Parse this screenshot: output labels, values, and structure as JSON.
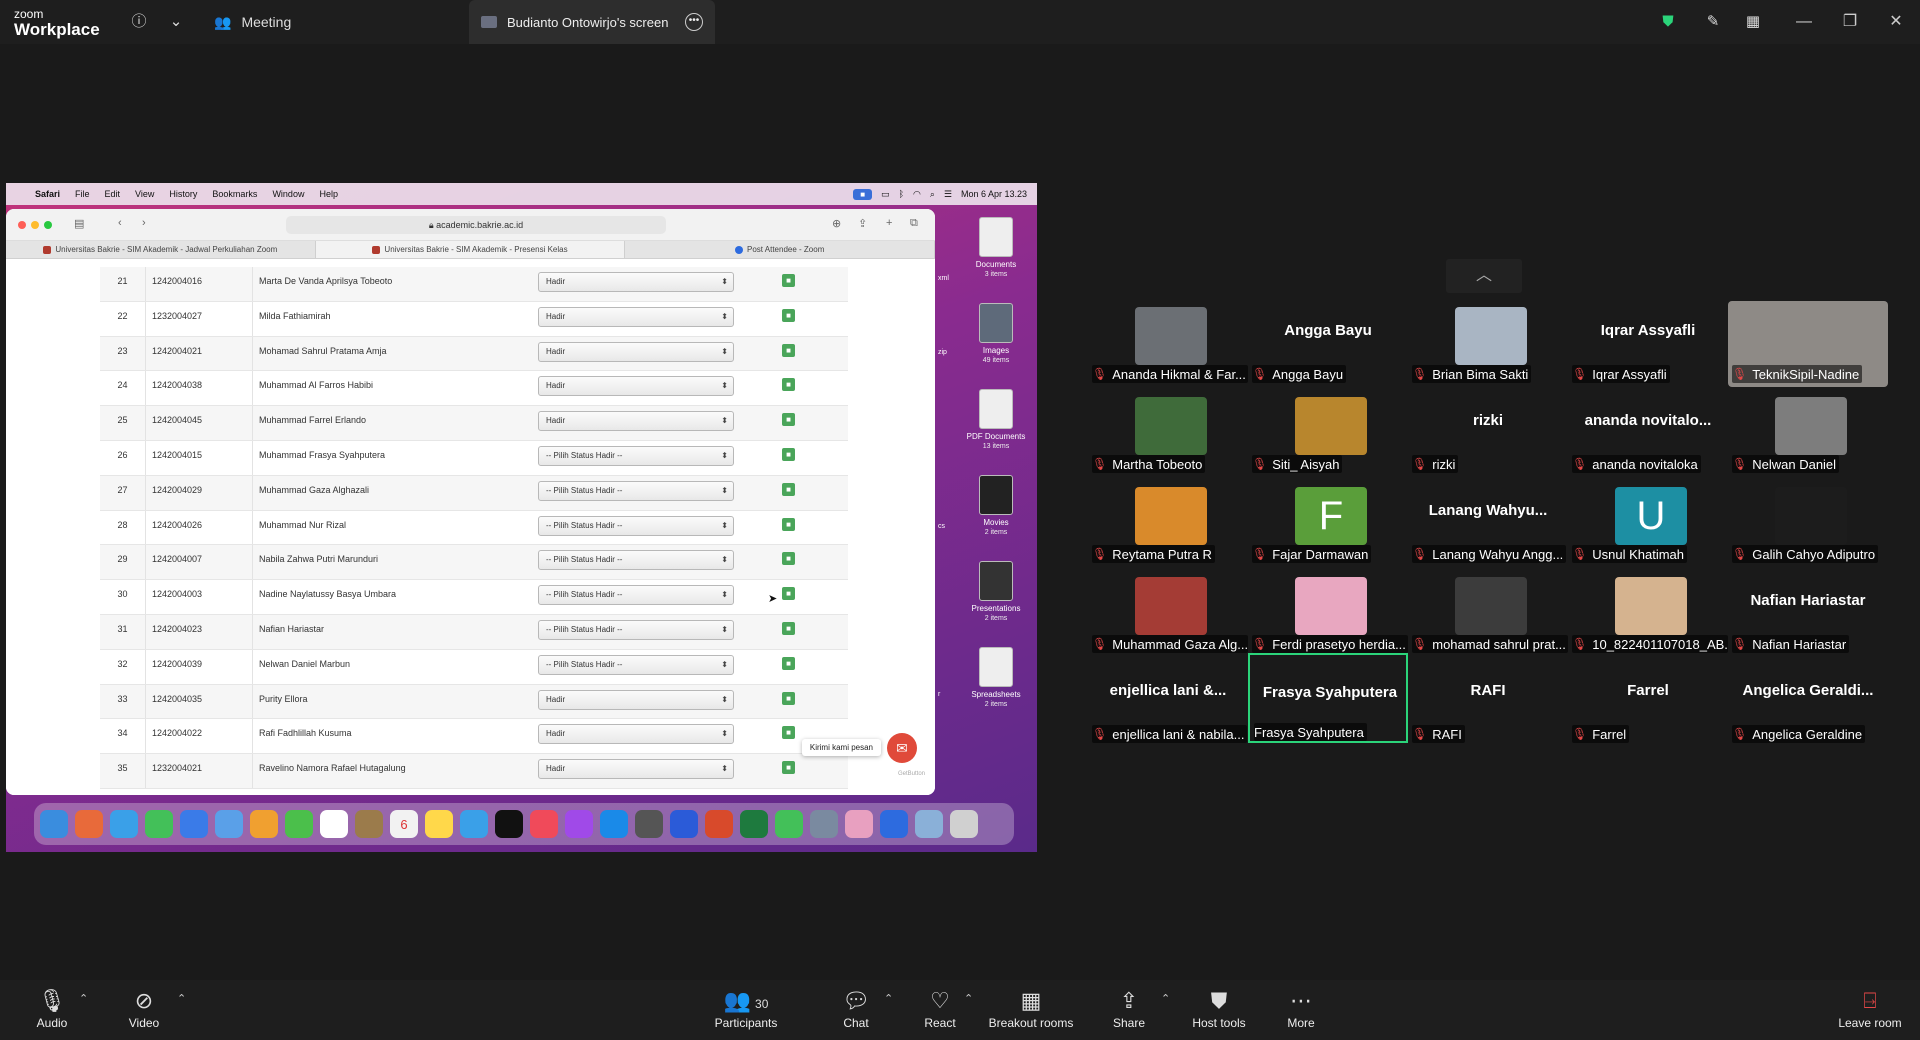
{
  "app": {
    "brand_small": "zoom",
    "brand_large": "Workplace"
  },
  "topbar": {
    "meeting_tab": "Meeting",
    "screen_tab": "Budianto Ontowirjo's screen"
  },
  "mac_menu": {
    "items": [
      "Safari",
      "File",
      "Edit",
      "View",
      "History",
      "Bookmarks",
      "Window",
      "Help"
    ],
    "datetime": "Mon 6 Apr  13.23",
    "zoom_indicator": "■"
  },
  "safari": {
    "url": "academic.bakrie.ac.id",
    "tabs": [
      "Universitas Bakrie - SIM Akademik - Jadwal Perkuliahan Zoom",
      "Universitas Bakrie - SIM Akademik - Presensi Kelas",
      "Post Attendee - Zoom"
    ],
    "rows": [
      {
        "no": "21",
        "nim": "1242004016",
        "name": "Marta De Vanda Aprilsya Tobeoto",
        "status": "Hadir"
      },
      {
        "no": "22",
        "nim": "1232004027",
        "name": "Milda Fathiamirah",
        "status": "Hadir"
      },
      {
        "no": "23",
        "nim": "1242004021",
        "name": "Mohamad Sahrul Pratama Amja",
        "status": "Hadir"
      },
      {
        "no": "24",
        "nim": "1242004038",
        "name": "Muhammad Al Farros Habibi",
        "status": "Hadir"
      },
      {
        "no": "25",
        "nim": "1242004045",
        "name": "Muhammad Farrel Erlando",
        "status": "Hadir"
      },
      {
        "no": "26",
        "nim": "1242004015",
        "name": "Muhammad Frasya Syahputera",
        "status": "-- Pilih Status Hadir --"
      },
      {
        "no": "27",
        "nim": "1242004029",
        "name": "Muhammad Gaza Alghazali",
        "status": "-- Pilih Status Hadir --"
      },
      {
        "no": "28",
        "nim": "1242004026",
        "name": "Muhammad Nur Rizal",
        "status": "-- Pilih Status Hadir --"
      },
      {
        "no": "29",
        "nim": "1242004007",
        "name": "Nabila Zahwa Putri Marunduri",
        "status": "-- Pilih Status Hadir --"
      },
      {
        "no": "30",
        "nim": "1242004003",
        "name": "Nadine Naylatussy Basya Umbara",
        "status": "-- Pilih Status Hadir --"
      },
      {
        "no": "31",
        "nim": "1242004023",
        "name": "Nafian Hariastar",
        "status": "-- Pilih Status Hadir --"
      },
      {
        "no": "32",
        "nim": "1242004039",
        "name": "Nelwan Daniel Marbun",
        "status": "-- Pilih Status Hadir --"
      },
      {
        "no": "33",
        "nim": "1242004035",
        "name": "Purity Ellora",
        "status": "Hadir"
      },
      {
        "no": "34",
        "nim": "1242004022",
        "name": "Rafi Fadhlillah Kusuma",
        "status": "Hadir"
      },
      {
        "no": "35",
        "nim": "1232004021",
        "name": "Ravelino Namora Rafael Hutagalung",
        "status": "Hadir"
      }
    ],
    "chat_tooltip": "Kirimi kami pesan",
    "getbutton": "GetButton"
  },
  "desktop": [
    {
      "name": "Documents",
      "count": "3 items"
    },
    {
      "name": "Images",
      "count": "49 items"
    },
    {
      "name": "PDF Documents",
      "count": "13 items"
    },
    {
      "name": "Movies",
      "count": "2 items"
    },
    {
      "name": "Presentations",
      "count": "2 items"
    },
    {
      "name": "Spreadsheets",
      "count": "2 items"
    }
  ],
  "side_fragments": [
    "xml",
    "zip",
    "cs",
    "r"
  ],
  "dock_date": "6",
  "gallery": [
    {
      "big": "",
      "label": "Ananda Hikmal & Far...",
      "kind": "photo",
      "color": "#6b6f74"
    },
    {
      "big": "Angga Bayu",
      "label": "Angga Bayu",
      "kind": "name"
    },
    {
      "big": "",
      "label": "Brian Bima Sakti",
      "kind": "photo",
      "color": "#a9b5c3"
    },
    {
      "big": "Iqrar Assyafli",
      "label": "Iqrar Assyafli",
      "kind": "name"
    },
    {
      "big": "",
      "label": "TeknikSipil-Nadine",
      "kind": "wide",
      "color": "#8e8a86"
    },
    {
      "big": "",
      "label": "Martha Tobeoto",
      "kind": "photo",
      "color": "#3f6b3a"
    },
    {
      "big": "",
      "label": "Siti_ Aisyah",
      "kind": "photo",
      "color": "#b8862d"
    },
    {
      "big": "rizki",
      "label": "rizki",
      "kind": "name"
    },
    {
      "big": "ananda  novitalo...",
      "label": "ananda novitaloka",
      "kind": "name"
    },
    {
      "big": "",
      "label": "Nelwan Daniel",
      "kind": "photo",
      "color": "#7d7d7d"
    },
    {
      "big": "",
      "label": "Reytama Putra R",
      "kind": "photo",
      "color": "#d98a2b"
    },
    {
      "big": "F",
      "label": "Fajar Darmawan",
      "kind": "letter",
      "color": "#5a9e3a"
    },
    {
      "big": "Lanang  Wahyu...",
      "label": "Lanang Wahyu Angg...",
      "kind": "name"
    },
    {
      "big": "U",
      "label": "Usnul Khatimah",
      "kind": "letter",
      "color": "#1d8fa3"
    },
    {
      "big": "",
      "label": "Galih Cahyo Adiputro",
      "kind": "photo",
      "color": "#1c1c1c"
    },
    {
      "big": "",
      "label": "Muhammad Gaza Alg...",
      "kind": "photo",
      "color": "#a43c35"
    },
    {
      "big": "",
      "label": "Ferdi prasetyo herdia...",
      "kind": "photo",
      "color": "#e8a7c0"
    },
    {
      "big": "",
      "label": "mohamad sahrul prat...",
      "kind": "photo",
      "color": "#3c3c3c"
    },
    {
      "big": "",
      "label": "10_822401107018_AB...",
      "kind": "photo",
      "color": "#d5b38f"
    },
    {
      "big": "Nafian Hariastar",
      "label": "Nafian Hariastar",
      "kind": "name"
    },
    {
      "big": "enjellica  lani  &...",
      "label": "enjellica lani & nabila...",
      "kind": "name"
    },
    {
      "big": "Frasya Syahputera",
      "label": "Frasya Syahputera",
      "kind": "name",
      "active": true
    },
    {
      "big": "RAFI",
      "label": "RAFI",
      "kind": "name"
    },
    {
      "big": "Farrel",
      "label": "Farrel",
      "kind": "name"
    },
    {
      "big": "Angelica  Geraldi...",
      "label": "Angelica Geraldine",
      "kind": "name"
    }
  ],
  "toolbar": {
    "audio": "Audio",
    "video": "Video",
    "participants": "Participants",
    "participants_count": "30",
    "chat": "Chat",
    "react": "React",
    "breakout": "Breakout rooms",
    "share": "Share",
    "host_tools": "Host tools",
    "more": "More",
    "leave": "Leave room"
  }
}
